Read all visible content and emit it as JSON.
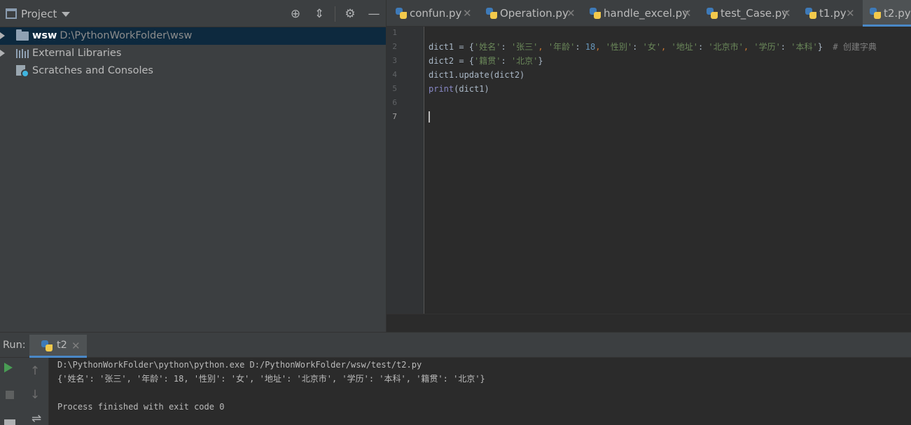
{
  "project": {
    "title": "Project",
    "tree": [
      {
        "name": "wsw",
        "path": "D:\\PythonWorkFolder\\wsw"
      },
      {
        "name": "External Libraries"
      },
      {
        "name": "Scratches and Consoles"
      }
    ]
  },
  "tabs": [
    {
      "label": "confun.py"
    },
    {
      "label": "Operation.py"
    },
    {
      "label": "handle_excel.py"
    },
    {
      "label": "test_Case.py"
    },
    {
      "label": "t1.py"
    },
    {
      "label": "t2.py",
      "active": true
    }
  ],
  "editor": {
    "line_numbers": [
      "1",
      "2",
      "3",
      "4",
      "5",
      "6",
      "7"
    ],
    "current_line": "7",
    "lines": [
      "",
      "dict1 = {'姓名': '张三', '年龄': 18, '性别': '女', '地址': '北京市', '学历': '本科'}  # 创建字典",
      "dict2 = {'籍贯': '北京'}",
      "dict1.update(dict2)",
      "print(dict1)",
      "",
      ""
    ]
  },
  "run": {
    "label": "Run:",
    "tab_label": "t2",
    "output": [
      "D:\\PythonWorkFolder\\python\\python.exe D:/PythonWorkFolder/wsw/test/t2.py",
      "{'姓名': '张三', '年龄': 18, '性别': '女', '地址': '北京市', '学历': '本科', '籍贯': '北京'}",
      "",
      "Process finished with exit code 0"
    ]
  },
  "colors": {
    "background": "#2b2b2b",
    "panel": "#3c3f41",
    "string": "#6a8759",
    "keyword": "#cc7832",
    "number": "#6897bb",
    "builtin": "#8888c6",
    "comment": "#808080",
    "selection": "#0d293e",
    "accent": "#4a88c7"
  }
}
